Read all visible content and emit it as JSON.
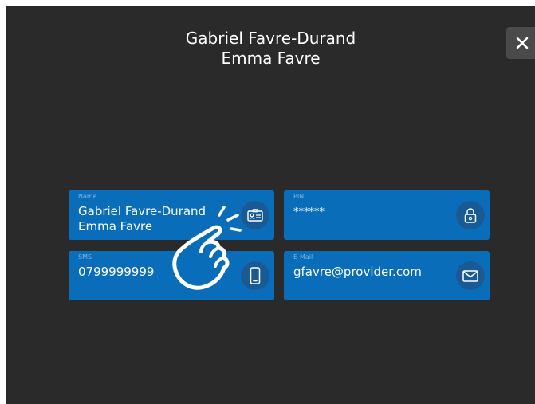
{
  "header": {
    "line1": "Gabriel Favre-Durand",
    "line2": "Emma Favre"
  },
  "close_icon": "close-icon",
  "cards": [
    {
      "label": "Name",
      "value_line1": "Gabriel Favre-Durand",
      "value_line2": "Emma Favre",
      "icon": "id-card-icon"
    },
    {
      "label": "PIN",
      "value": "******",
      "icon": "lock-icon"
    },
    {
      "label": "SMS",
      "value": "0799999999",
      "icon": "phone-icon"
    },
    {
      "label": "E-Mail",
      "value": "gfavre@provider.com",
      "icon": "mail-icon"
    }
  ],
  "colors": {
    "background": "#2a2a2a",
    "card": "#0a6db9",
    "icon_circle": "#1a5a94"
  }
}
